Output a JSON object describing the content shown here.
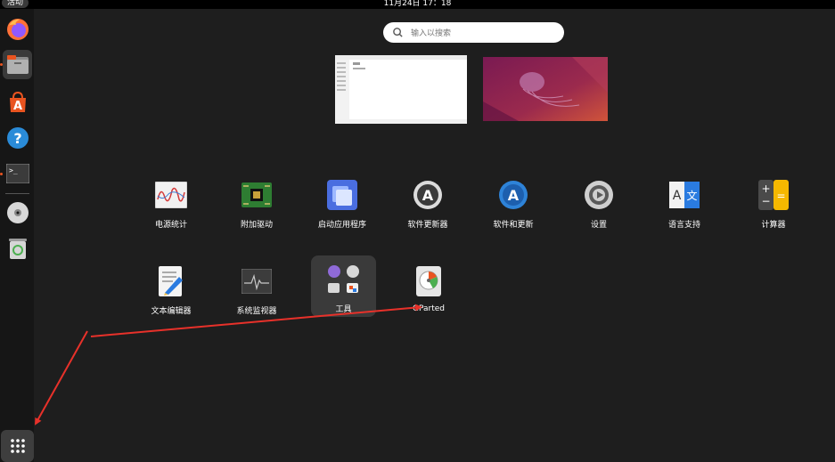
{
  "topbar": {
    "activities": "活动",
    "clock": "11月24日  17：18"
  },
  "search": {
    "placeholder": "输入以搜索"
  },
  "dock": {
    "items": [
      "firefox-icon",
      "files-icon",
      "app-store-icon",
      "help-icon",
      "terminal-icon",
      "disc-icon",
      "trash-icon"
    ],
    "show_apps": "grid-icon"
  },
  "apps": [
    {
      "label": "电源统计",
      "icon": "power-statistics-icon"
    },
    {
      "label": "附加驱动",
      "icon": "additional-drivers-icon"
    },
    {
      "label": "启动应用程序",
      "icon": "startup-apps-icon"
    },
    {
      "label": "软件更新器",
      "icon": "software-updater-icon"
    },
    {
      "label": "软件和更新",
      "icon": "software-and-updates-icon"
    },
    {
      "label": "设置",
      "icon": "settings-icon"
    },
    {
      "label": "语言支持",
      "icon": "language-support-icon"
    },
    {
      "label": "计算器",
      "icon": "calculator-icon"
    },
    {
      "label": "文本编辑器",
      "icon": "text-editor-icon"
    },
    {
      "label": "系统监视器",
      "icon": "system-monitor-icon"
    },
    {
      "label": "工具",
      "icon": "tools-folder-icon"
    },
    {
      "label": "GParted",
      "icon": "gparted-icon"
    }
  ],
  "colors": {
    "accent": "#e95420",
    "arrow": "#e8312a",
    "background": "#1e1e1e"
  }
}
